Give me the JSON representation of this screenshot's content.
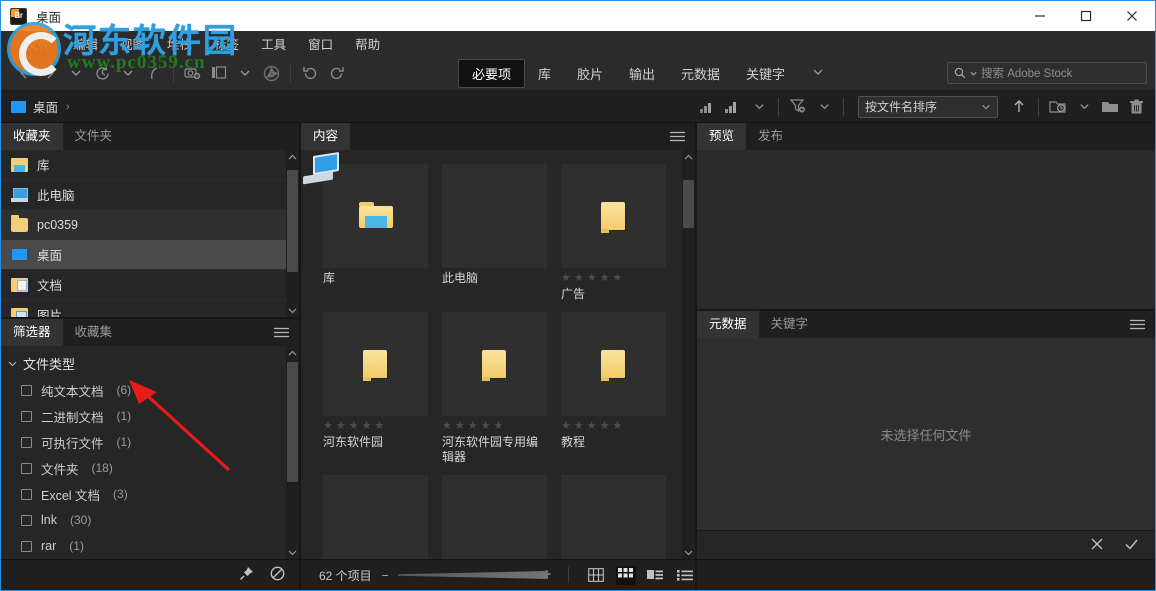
{
  "window": {
    "title": "桌面",
    "app_icon": "br-icon",
    "minimize": "—",
    "maximize": "□",
    "close": "✕"
  },
  "menu": {
    "items": [
      "文件",
      "编辑",
      "视图",
      "堆栈",
      "标签",
      "工具",
      "窗口",
      "帮助"
    ]
  },
  "toolbar": {
    "icons": [
      "back-arrow",
      "forward-arrow",
      "dropdown-caret",
      "recent-folders",
      "caret",
      "return-arrow",
      "get-photos-from-camera",
      "refine",
      "caret",
      "open-in-camera-raw",
      "rotate-counterclockwise",
      "rotate-clockwise"
    ],
    "workspace_tabs": [
      {
        "label": "必要项",
        "active": true
      },
      {
        "label": "库",
        "active": false
      },
      {
        "label": "胶片",
        "active": false
      },
      {
        "label": "输出",
        "active": false
      },
      {
        "label": "元数据",
        "active": false
      },
      {
        "label": "关键字",
        "active": false
      }
    ],
    "workspace_more": "⌄",
    "search": {
      "placeholder": "搜索 Adobe Stock",
      "value": "",
      "icon": "search-icon"
    }
  },
  "pathbar": {
    "crumbs": [
      {
        "label": "桌面",
        "icon": "desktop-folder-icon"
      }
    ],
    "separator": "›",
    "sort": {
      "label": "按文件名排序",
      "caret": "⌄",
      "direction": "↑"
    },
    "icons": [
      "filter-rating",
      "filter-rating-menu",
      "filter-funnel",
      "new-folder-recent",
      "new-folder",
      "delete"
    ]
  },
  "favorites": {
    "tabs": [
      {
        "label": "收藏夹",
        "active": true
      },
      {
        "label": "文件夹",
        "active": false
      }
    ],
    "items": [
      {
        "label": "库",
        "icon": "library-icon",
        "state": "normal"
      },
      {
        "label": "此电脑",
        "icon": "computer-icon",
        "state": "normal"
      },
      {
        "label": "pc0359",
        "icon": "folder-icon",
        "state": "hover"
      },
      {
        "label": "桌面",
        "icon": "desktop-icon",
        "state": "selected"
      },
      {
        "label": "文档",
        "icon": "documents-icon",
        "state": "normal"
      },
      {
        "label": "图片",
        "icon": "pictures-icon",
        "state": "normal"
      }
    ]
  },
  "filter": {
    "tabs": [
      {
        "label": "筛选器",
        "active": true
      },
      {
        "label": "收藏集",
        "active": false
      }
    ],
    "menu_icon": "hamburger-icon",
    "group": {
      "label": "文件类型",
      "caret": "⌄",
      "items": [
        {
          "label": "纯文本文档",
          "count": "(6)",
          "checked": false
        },
        {
          "label": "二进制文档",
          "count": "(1)",
          "checked": false
        },
        {
          "label": "可执行文件",
          "count": "(1)",
          "checked": false
        },
        {
          "label": "文件夹",
          "count": "(18)",
          "checked": false
        },
        {
          "label": "Excel 文档",
          "count": "(3)",
          "checked": false
        },
        {
          "label": "lnk",
          "count": "(30)",
          "checked": false
        },
        {
          "label": "rar",
          "count": "(1)",
          "checked": false
        }
      ]
    },
    "footer_icons": [
      "keep-filter-pin-icon",
      "clear-filter-icon"
    ]
  },
  "content": {
    "tabs": [
      {
        "label": "内容",
        "active": true
      }
    ],
    "menu_icon": "hamburger-icon",
    "items": [
      {
        "label": "库",
        "icon": "library-folder",
        "stars": 0,
        "show_stars": false
      },
      {
        "label": "此电脑",
        "icon": "computer",
        "stars": 0,
        "show_stars": false
      },
      {
        "label": "广告",
        "icon": "folder",
        "stars": 0,
        "show_stars": true
      },
      {
        "label": "河东软件园",
        "icon": "folder",
        "stars": 0,
        "show_stars": true
      },
      {
        "label": "河东软件园专用编辑器",
        "icon": "folder",
        "stars": 0,
        "show_stars": true
      },
      {
        "label": "教程",
        "icon": "folder",
        "stars": 0,
        "show_stars": true
      },
      {
        "label": "",
        "icon": "folder",
        "stars": 0,
        "show_stars": false
      },
      {
        "label": "",
        "icon": "folder",
        "stars": 0,
        "show_stars": false
      },
      {
        "label": "",
        "icon": "folder",
        "stars": 0,
        "show_stars": false
      }
    ],
    "star_glyph": "★"
  },
  "preview": {
    "tabs": [
      {
        "label": "预览",
        "active": true
      },
      {
        "label": "发布",
        "active": false
      }
    ]
  },
  "metadata": {
    "tabs": [
      {
        "label": "元数据",
        "active": true
      },
      {
        "label": "关键字",
        "active": false
      }
    ],
    "menu_icon": "hamburger-icon",
    "empty_text": "未选择任何文件",
    "cancel_icon": "✕",
    "apply_icon": "✓"
  },
  "statusbar": {
    "count": "62 个项目",
    "zoom_minus": "−",
    "zoom_plus": "+",
    "view_buttons": [
      {
        "name": "grid-lock-view",
        "active": false
      },
      {
        "name": "thumbnail-view",
        "active": true
      },
      {
        "name": "details-view",
        "active": false
      },
      {
        "name": "list-view",
        "active": false
      }
    ]
  },
  "watermark": {
    "text": "河东软件园",
    "url": "www.pc0359.cn"
  },
  "colors": {
    "accent": "#2a8fe0",
    "panel": "#262626",
    "chrome": "#1f1f1f",
    "folder": "#f3cc68",
    "annotation": "#e81b1b"
  }
}
